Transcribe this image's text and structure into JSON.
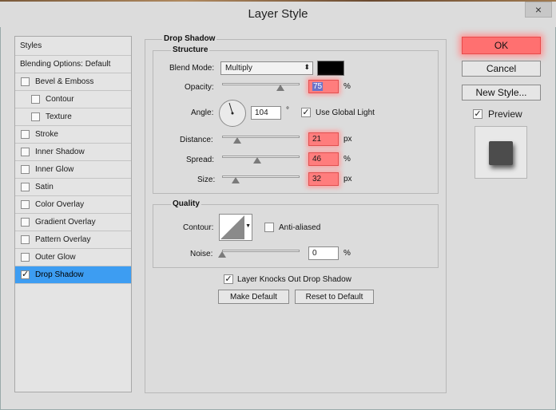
{
  "window": {
    "title": "Layer Style",
    "close_label": "×"
  },
  "sidebar": {
    "header": "Styles",
    "blending": "Blending Options: Default",
    "items": [
      {
        "label": "Bevel & Emboss",
        "checked": false
      },
      {
        "label": "Contour",
        "checked": false
      },
      {
        "label": "Texture",
        "checked": false
      },
      {
        "label": "Stroke",
        "checked": false
      },
      {
        "label": "Inner Shadow",
        "checked": false
      },
      {
        "label": "Inner Glow",
        "checked": false
      },
      {
        "label": "Satin",
        "checked": false
      },
      {
        "label": "Color Overlay",
        "checked": false
      },
      {
        "label": "Gradient Overlay",
        "checked": false
      },
      {
        "label": "Pattern Overlay",
        "checked": false
      },
      {
        "label": "Outer Glow",
        "checked": false
      },
      {
        "label": "Drop Shadow",
        "checked": true
      }
    ]
  },
  "drop_shadow": {
    "title": "Drop Shadow",
    "structure_title": "Structure",
    "blend_mode_label": "Blend Mode:",
    "blend_mode_value": "Multiply",
    "shadow_color": "#000000",
    "opacity_label": "Opacity:",
    "opacity_value": "75",
    "opacity_unit": "%",
    "angle_label": "Angle:",
    "angle_value": "104",
    "angle_unit": "°",
    "use_global_light_label": "Use Global Light",
    "distance_label": "Distance:",
    "distance_value": "21",
    "distance_unit": "px",
    "spread_label": "Spread:",
    "spread_value": "46",
    "spread_unit": "%",
    "size_label": "Size:",
    "size_value": "32",
    "size_unit": "px",
    "quality_title": "Quality",
    "contour_label": "Contour:",
    "anti_aliased_label": "Anti-aliased",
    "noise_label": "Noise:",
    "noise_value": "0",
    "noise_unit": "%",
    "knocks_out_label": "Layer Knocks Out Drop Shadow",
    "make_default": "Make Default",
    "reset_default": "Reset to Default"
  },
  "actions": {
    "ok": "OK",
    "cancel": "Cancel",
    "new_style": "New Style...",
    "preview_label": "Preview"
  },
  "colors": {
    "highlight": "#ff7070",
    "selected_row": "#3d9df2"
  }
}
